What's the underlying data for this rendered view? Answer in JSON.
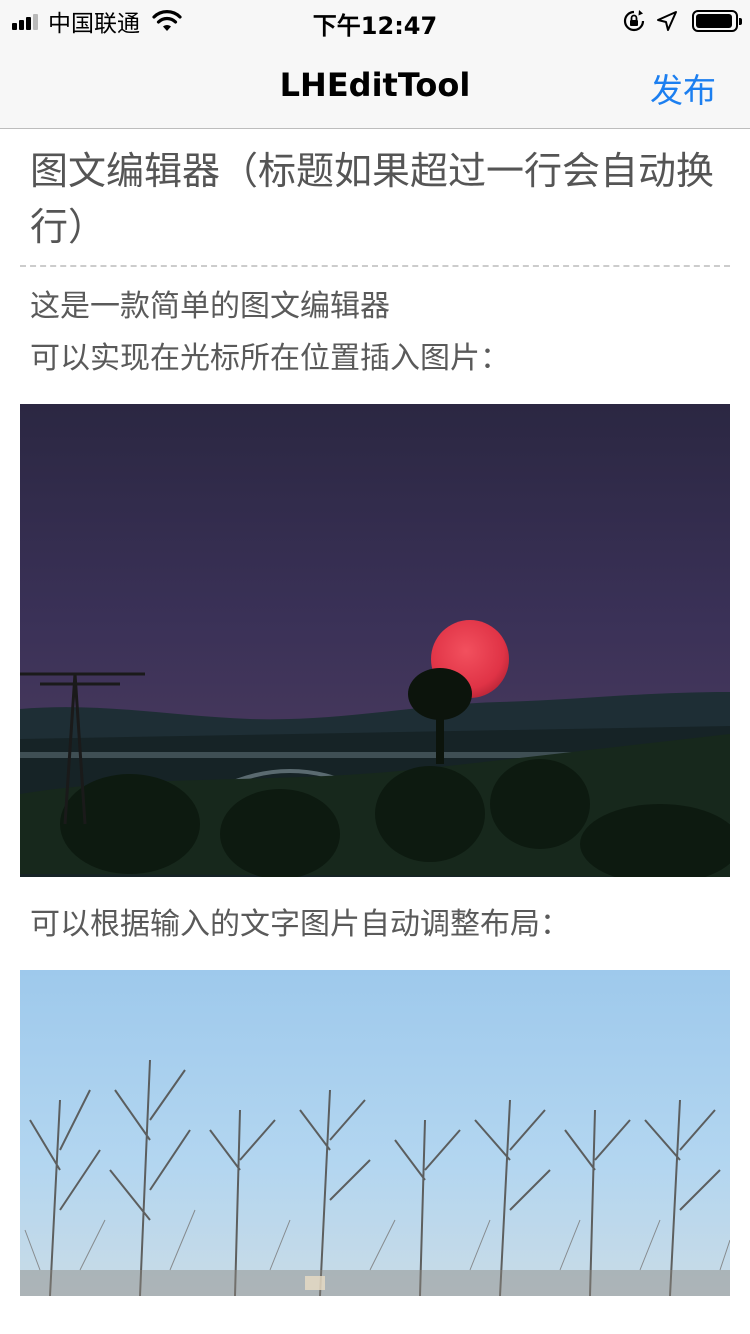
{
  "status_bar": {
    "carrier": "中国联通",
    "time": "下午12:47",
    "battery_level": 0.95
  },
  "nav": {
    "title": "LHEditTool",
    "action_label": "发布"
  },
  "editor": {
    "title": "图文编辑器（标题如果超过一行会自动换行）",
    "paragraph_1": "这是一款简单的图文编辑器\n可以实现在光标所在位置插入图片：",
    "paragraph_2": "可以根据输入的文字图片自动调整布局："
  },
  "colors": {
    "accent": "#1c7ff0",
    "nav_background": "#f7f7f7",
    "body_text": "#5a5a5a"
  },
  "icons": {
    "signal": "signal-icon",
    "wifi": "wifi-icon",
    "orientation_lock": "orientation-lock-icon",
    "location": "location-arrow-icon",
    "battery": "battery-icon"
  }
}
